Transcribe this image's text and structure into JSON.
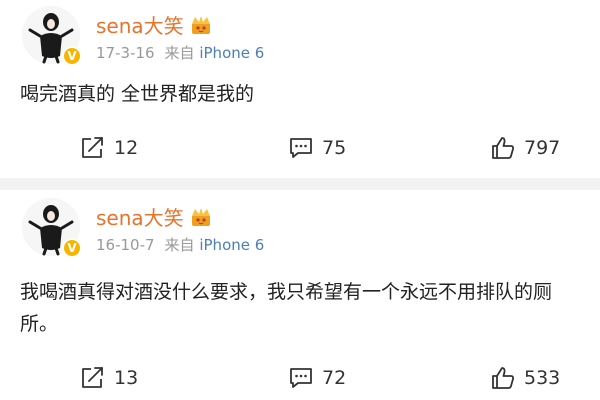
{
  "posts": [
    {
      "username": "sena大笑",
      "date": "17-3-16",
      "source_prefix": "来自",
      "device": "iPhone 6",
      "text": "喝完酒真的 全世界都是我的",
      "reposts": "12",
      "comments": "75",
      "likes": "797"
    },
    {
      "username": "sena大笑",
      "date": "16-10-7",
      "source_prefix": "来自",
      "device": "iPhone 6",
      "text": "我喝酒真得对酒没什么要求，我只希望有一个永远不用排队的厕所。",
      "reposts": "13",
      "comments": "72",
      "likes": "533"
    }
  ],
  "colors": {
    "username": "#e8732a",
    "device": "#4a7fb8",
    "verified_badge": "#f7b500",
    "divider": "#f2f2f2"
  },
  "icons": [
    "repost-icon",
    "comment-icon",
    "like-icon",
    "crown-icon",
    "verified-badge-icon"
  ]
}
